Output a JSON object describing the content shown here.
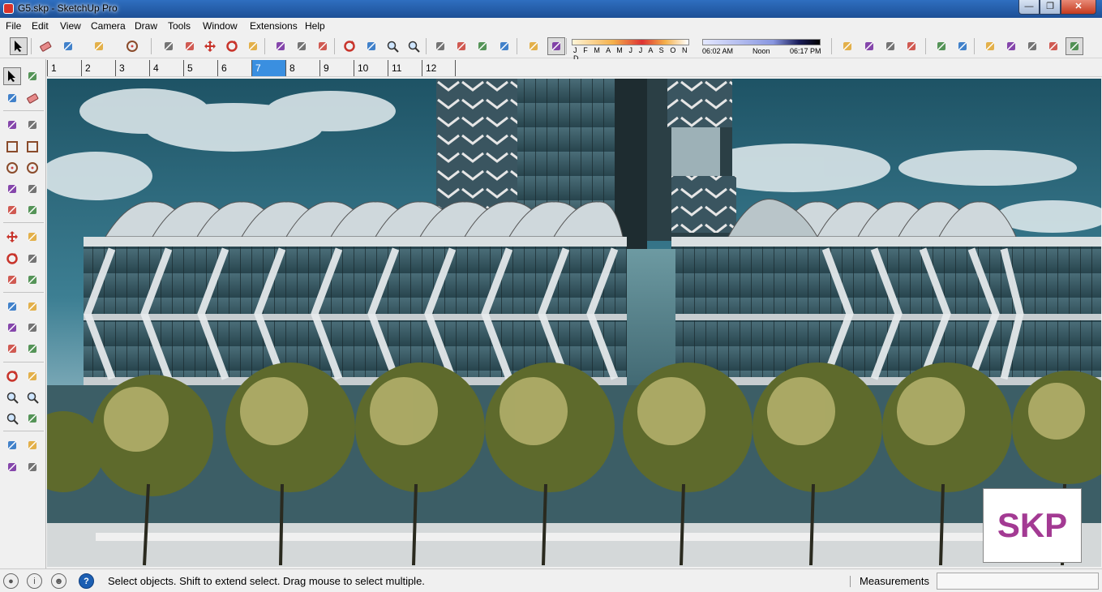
{
  "window": {
    "title": "G5.skp - SketchUp Pro",
    "minimize": "—",
    "maximize": "❐",
    "close": "✕"
  },
  "menu": [
    "File",
    "Edit",
    "View",
    "Camera",
    "Draw",
    "Tools",
    "Window",
    "Extensions",
    "Help"
  ],
  "toolbar_icons": [
    "select-icon",
    "eraser-icon",
    "pencil-icon",
    "arc-icon",
    "circle-icon",
    "push-pull-icon",
    "follow-me-icon",
    "move-icon",
    "rotate-icon",
    "scale-icon",
    "tape-measure-icon",
    "text-icon",
    "paint-bucket-icon",
    "orbit-icon",
    "pan-icon",
    "zoom-icon",
    "zoom-extents-icon",
    "previous-view-icon",
    "3d-warehouse-icon",
    "extension-warehouse-icon",
    "layout-icon",
    "shadows-toggle-icon",
    "fog-toggle-icon"
  ],
  "shadow_settings": {
    "months": "J F M A M J J A S O N D",
    "time_start": "06:02 AM",
    "time_mid": "Noon",
    "time_end": "06:17 PM"
  },
  "view_icons": [
    "section-plane-icon",
    "section-display-icon",
    "walk-icon",
    "look-around-icon",
    "iso-view-icon",
    "top-view-icon",
    "front-view-icon",
    "right-view-icon",
    "back-view-icon",
    "left-view-icon",
    "xray-style-icon"
  ],
  "scenes": [
    "1",
    "2",
    "3",
    "4",
    "5",
    "6",
    "7",
    "8",
    "9",
    "10",
    "11",
    "12"
  ],
  "selected_scene": "7",
  "palette_icons": [
    "select-icon",
    "component-icon",
    "paint-bucket-icon",
    "eraser-icon",
    "line-icon",
    "freehand-icon",
    "rectangle-icon",
    "rotated-rectangle-icon",
    "circle-icon",
    "polygon-icon",
    "arc-icon",
    "two-point-arc-icon",
    "pie-icon",
    "three-point-arc-icon",
    "move-icon",
    "push-pull-icon",
    "rotate-icon",
    "follow-me-icon",
    "scale-icon",
    "offset-icon",
    "tape-measure-icon",
    "dimension-icon",
    "protractor-icon",
    "text-icon",
    "axes-icon",
    "3d-text-icon",
    "orbit-icon",
    "pan-icon",
    "zoom-icon",
    "zoom-window-icon",
    "zoom-extents-icon",
    "previous-icon",
    "position-camera-icon",
    "look-around-icon",
    "walk-icon",
    "section-plane-icon"
  ],
  "viewport": {
    "badge_text": "SKP"
  },
  "status": {
    "message": "Select objects. Shift to extend select. Drag mouse to select multiple.",
    "measurements_label": "Measurements",
    "measurements_value": ""
  }
}
